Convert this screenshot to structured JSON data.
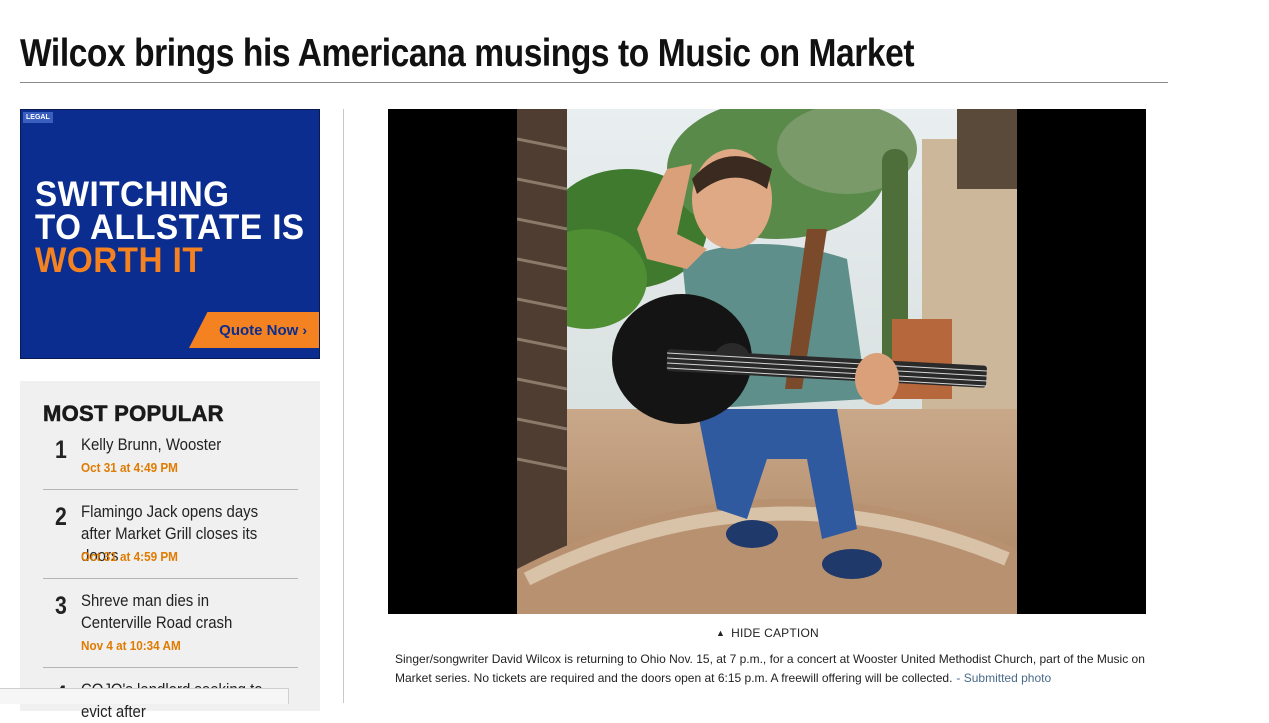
{
  "article": {
    "headline": "Wilcox brings his Americana musings to Music on Market"
  },
  "ad": {
    "badge": "LEGAL",
    "line1": "SWITCHING",
    "line2": "TO ALLSTATE IS",
    "line3": "WORTH IT",
    "cta": "Quote Now",
    "cta_icon": "chevron-right-icon",
    "colors": {
      "background": "#0a2d8f",
      "accent": "#f58220"
    }
  },
  "most_popular": {
    "title": "MOST POPULAR",
    "items": [
      {
        "rank": "1",
        "title": "Kelly Brunn, Wooster",
        "date": "Oct 31 at 4:49 PM"
      },
      {
        "rank": "2",
        "title": "Flamingo Jack opens days after Market Grill closes its doors",
        "date": "Oct 31 at 4:59 PM"
      },
      {
        "rank": "3",
        "title": "Shreve man dies in Centerville Road crash",
        "date": "Nov 4 at 10:34 AM"
      },
      {
        "rank": "4",
        "title": "COJO's landlord seeking to evict after",
        "date": ""
      }
    ],
    "date_color": "#e07b00"
  },
  "photo": {
    "hide_caption_label": "HIDE CAPTION",
    "caption": "Singer/songwriter David Wilcox is returning to Ohio Nov. 15, at 7 p.m., for a concert at Wooster United Methodist Church, part of the Music on Market series. No tickets are required and the doors open at 6:15 p.m. A freewill offering will be collected.",
    "credit": "- Submitted photo"
  }
}
